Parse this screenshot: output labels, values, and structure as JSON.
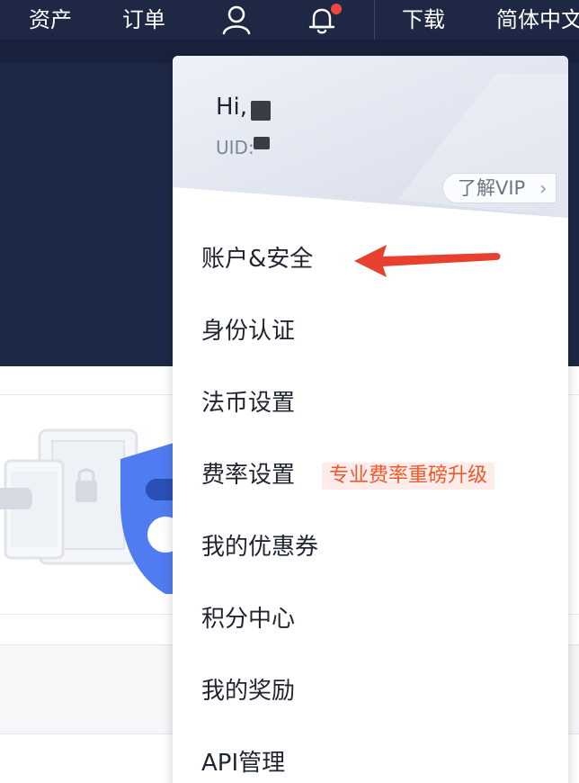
{
  "topnav": {
    "items": [
      "资产",
      "订单",
      "下载",
      "简体中文"
    ],
    "user_icon": "user-icon",
    "bell_icon": "bell-icon",
    "bell_badge_color": "#f0483e"
  },
  "dropdown": {
    "greeting": "Hi,",
    "uid_label": "UID:",
    "vip_label": "了解VIP",
    "vip_chevron": "›",
    "menu": [
      {
        "label": "账户&安全"
      },
      {
        "label": "身份认证"
      },
      {
        "label": "法币设置"
      },
      {
        "label": "费率设置",
        "badge": "专业费率重磅升级"
      },
      {
        "label": "我的优惠券"
      },
      {
        "label": "积分中心"
      },
      {
        "label": "我的奖励"
      },
      {
        "label": "API管理"
      }
    ]
  },
  "colors": {
    "nav_bg": "#1e2845",
    "accent_badge_text": "#ee5a2c",
    "annotation_arrow": "#e8402e"
  }
}
